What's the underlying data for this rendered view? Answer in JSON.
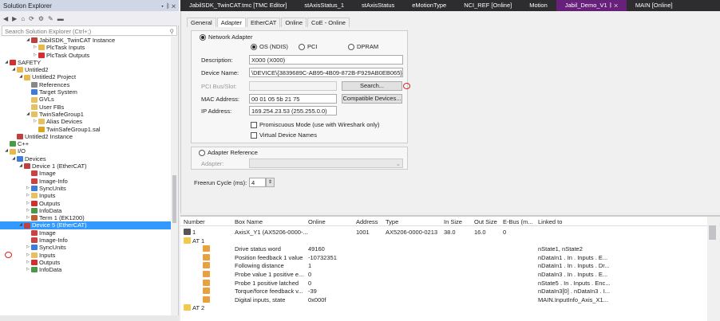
{
  "solution_explorer": {
    "title": "Solution Explorer",
    "title_controls": "▾ ᛒ ✕",
    "search_placeholder": "Search Solution Explorer (Ctrl+;)",
    "tree": [
      {
        "label": "JabilSDK_TwinCAT Instance",
        "level": 3,
        "arrow": "◢",
        "color": "#c04040"
      },
      {
        "label": "PlcTask Inputs",
        "level": 4,
        "arrow": "▷",
        "color": "#e8b84a"
      },
      {
        "label": "PlcTask Outputs",
        "level": 4,
        "arrow": "▷",
        "color": "#d03030"
      },
      {
        "label": "SAFETY",
        "level": 0,
        "arrow": "◢",
        "color": "#d03030"
      },
      {
        "label": "Untitled2",
        "level": 1,
        "arrow": "◢",
        "color": "#e8b84a"
      },
      {
        "label": "Untitled2 Project",
        "level": 2,
        "arrow": "◢",
        "color": "#e8b84a"
      },
      {
        "label": "References",
        "level": 3,
        "arrow": "",
        "color": "#888"
      },
      {
        "label": "Target System",
        "level": 3,
        "arrow": "",
        "color": "#3b7dd8"
      },
      {
        "label": "GVLs",
        "level": 3,
        "arrow": "",
        "color": "#e8c060"
      },
      {
        "label": "User FBs",
        "level": 3,
        "arrow": "",
        "color": "#e8c060"
      },
      {
        "label": "TwinSafeGroup1",
        "level": 3,
        "arrow": "◢",
        "color": "#e8c060"
      },
      {
        "label": "Alias Devices",
        "level": 4,
        "arrow": "▷",
        "color": "#e8c060"
      },
      {
        "label": "TwinSafeGroup1.sal",
        "level": 4,
        "arrow": "",
        "color": "#d9a520"
      },
      {
        "label": "Untitled2 Instance",
        "level": 1,
        "arrow": "",
        "color": "#c04040"
      },
      {
        "label": "C++",
        "level": 0,
        "arrow": "",
        "color": "#4a9a4a"
      },
      {
        "label": "I/O",
        "level": 0,
        "arrow": "◢",
        "color": "#e8b84a"
      },
      {
        "label": "Devices",
        "level": 1,
        "arrow": "◢",
        "color": "#3b7dd8"
      },
      {
        "label": "Device 1 (EtherCAT)",
        "level": 2,
        "arrow": "◢",
        "color": "#c04040"
      },
      {
        "label": "Image",
        "level": 3,
        "arrow": "",
        "color": "#d04040"
      },
      {
        "label": "Image-Info",
        "level": 3,
        "arrow": "",
        "color": "#d04040"
      },
      {
        "label": "SyncUnits",
        "level": 3,
        "arrow": "▷",
        "color": "#3b7dd8"
      },
      {
        "label": "Inputs",
        "level": 3,
        "arrow": "▷",
        "color": "#e8c060"
      },
      {
        "label": "Outputs",
        "level": 3,
        "arrow": "▷",
        "color": "#d03030"
      },
      {
        "label": "InfoData",
        "level": 3,
        "arrow": "▷",
        "color": "#4a9a4a"
      },
      {
        "label": "Term 1 (EK1200)",
        "level": 3,
        "arrow": "▷",
        "color": "#c06030"
      },
      {
        "label": "Device 5 (EtherCAT)",
        "level": 2,
        "arrow": "◢",
        "color": "#c04040",
        "selected": true
      },
      {
        "label": "Image",
        "level": 3,
        "arrow": "",
        "color": "#d04040"
      },
      {
        "label": "Image-Info",
        "level": 3,
        "arrow": "",
        "color": "#d04040"
      },
      {
        "label": "SyncUnits",
        "level": 3,
        "arrow": "▷",
        "color": "#3b7dd8"
      },
      {
        "label": "Inputs",
        "level": 3,
        "arrow": "▷",
        "color": "#e8c060"
      },
      {
        "label": "Outputs",
        "level": 3,
        "arrow": "▷",
        "color": "#d03030"
      },
      {
        "label": "InfoData",
        "level": 3,
        "arrow": "▷",
        "color": "#4a9a4a"
      }
    ]
  },
  "doc_tabs": [
    {
      "label": "JabilSDK_TwinCAT.tmc [TMC Editor]",
      "active": false
    },
    {
      "label": "stAxisStatus_1",
      "active": false
    },
    {
      "label": "stAxisStatus",
      "active": false
    },
    {
      "label": "eMotionType",
      "active": false
    },
    {
      "label": "NCI_REF [Online]",
      "active": false
    },
    {
      "label": "Motion",
      "active": false
    },
    {
      "label": "Jabil_Demo_V1 ᛒ ✕",
      "active": true
    },
    {
      "label": "MAIN [Online]",
      "active": false
    }
  ],
  "sub_tabs": [
    "General",
    "Adapter",
    "EtherCAT",
    "Online",
    "CoE - Online"
  ],
  "adapter": {
    "network_adapter_label": "Network Adapter",
    "os_label": "OS (NDIS)",
    "pci_label": "PCI",
    "dpram_label": "DPRAM",
    "description_label": "Description:",
    "description_value": "X000 (X000)",
    "device_name_label": "Device Name:",
    "device_name_value": "\\DEVICE\\{3839689C-AB95-4B09-872B-F929AB0EB065}",
    "pci_bus_label": "PCI Bus/Slot:",
    "search_button": "Search...",
    "mac_label": "MAC Address:",
    "mac_value": "00 01 05 5b 21 75",
    "compatible_button": "Compatible Devices...",
    "ip_label": "IP Address:",
    "ip_value": "169.254.23.53 (255.255.0.0)",
    "promiscuous_label": "Promiscuous Mode (use with Wireshark only)",
    "virtual_label": "Virtual Device Names",
    "adapter_reference_label": "Adapter Reference",
    "adapter_label": "Adapter:",
    "freerun_label": "Freerun Cycle (ms):",
    "freerun_value": "4"
  },
  "list": {
    "headers": [
      "Number",
      "Box Name",
      "Online",
      "Address",
      "Type",
      "In Size",
      "Out Size",
      "E-Bus (m...",
      "Linked to"
    ],
    "rows": [
      {
        "kind": "box",
        "number": "1",
        "name": "AxisX_Y1 (AX5206-0000-...",
        "online": "",
        "address": "1001",
        "type": "AX5206-0000-0213",
        "in": "38.0",
        "out": "16.0",
        "ebus": "0",
        "linked": ""
      },
      {
        "kind": "group",
        "number": "AT 1",
        "name": "",
        "online": "",
        "address": "",
        "type": "",
        "in": "",
        "out": "",
        "ebus": "",
        "linked": ""
      },
      {
        "kind": "var",
        "number": "",
        "name": "Drive status word",
        "online": "49160",
        "address": "",
        "type": "",
        "in": "",
        "out": "",
        "ebus": "",
        "linked": "nState1, nState2"
      },
      {
        "kind": "var",
        "number": "",
        "name": "Position feedback 1 value",
        "online": "-10732351",
        "address": "",
        "type": "",
        "in": "",
        "out": "",
        "ebus": "",
        "linked": "nDataIn1 . In . Inputs . E..."
      },
      {
        "kind": "var",
        "number": "",
        "name": "Following distance",
        "online": "1",
        "address": "",
        "type": "",
        "in": "",
        "out": "",
        "ebus": "",
        "linked": "nDataIn1 . In . Inputs . Dr..."
      },
      {
        "kind": "var",
        "number": "",
        "name": "Probe value 1 positive e...",
        "online": "0",
        "address": "",
        "type": "",
        "in": "",
        "out": "",
        "ebus": "",
        "linked": "nDataIn3 . In . Inputs . E..."
      },
      {
        "kind": "var",
        "number": "",
        "name": "Probe 1 positive latched",
        "online": "0",
        "address": "",
        "type": "",
        "in": "",
        "out": "",
        "ebus": "",
        "linked": "nState5 . In . Inputs . Enc..."
      },
      {
        "kind": "var",
        "number": "",
        "name": "Torque/force feedback v...",
        "online": "-39",
        "address": "",
        "type": "",
        "in": "",
        "out": "",
        "ebus": "",
        "linked": "nDataIn3[0] . nDataIn3 . I..."
      },
      {
        "kind": "var",
        "number": "",
        "name": "Digital inputs, state",
        "online": "0x000f",
        "address": "",
        "type": "",
        "in": "",
        "out": "",
        "ebus": "",
        "linked": "MAIN.InputInfo_Axis_X1..."
      },
      {
        "kind": "group",
        "number": "AT 2",
        "name": "",
        "online": "",
        "address": "",
        "type": "",
        "in": "",
        "out": "",
        "ebus": "",
        "linked": ""
      }
    ]
  }
}
